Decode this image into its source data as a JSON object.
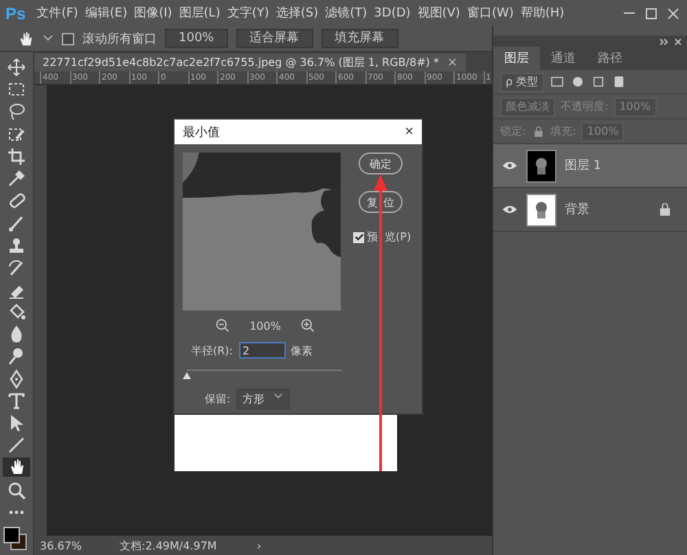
{
  "app": {
    "logo": "Ps"
  },
  "menu": [
    "文件(F)",
    "编辑(E)",
    "图像(I)",
    "图层(L)",
    "文字(Y)",
    "选择(S)",
    "滤镜(T)",
    "3D(D)",
    "视图(V)",
    "窗口(W)",
    "帮助(H)"
  ],
  "options_bar": {
    "scroll_all": {
      "label": "滚动所有窗口",
      "checked": false
    },
    "buttons": [
      "100%",
      "适合屏幕",
      "填充屏幕"
    ]
  },
  "document_tab": {
    "title": "22771cf29d51e4c8b2c7ac2e2f7c6755.jpeg @ 36.7% (图层 1, RGB/8#) *",
    "close": "×"
  },
  "ruler": [
    "400",
    "300",
    "200",
    "100",
    "0",
    "100",
    "200",
    "300",
    "400",
    "500",
    "600",
    "700",
    "800",
    "900",
    "1000",
    "1"
  ],
  "tools": [
    {
      "kind": "move",
      "selected": false
    },
    {
      "kind": "marquee",
      "selected": false
    },
    {
      "kind": "lasso",
      "selected": false
    },
    {
      "kind": "quickselect",
      "selected": false
    },
    {
      "kind": "crop",
      "selected": false
    },
    {
      "kind": "eyedropper",
      "selected": false
    },
    {
      "kind": "healing",
      "selected": false
    },
    {
      "kind": "brush",
      "selected": false
    },
    {
      "kind": "stamp",
      "selected": false
    },
    {
      "kind": "historybrush",
      "selected": false
    },
    {
      "kind": "eraser",
      "selected": false
    },
    {
      "kind": "bucket",
      "selected": false
    },
    {
      "kind": "blur",
      "selected": false
    },
    {
      "kind": "dodge",
      "selected": false
    },
    {
      "kind": "pen",
      "selected": false
    },
    {
      "kind": "type",
      "selected": false
    },
    {
      "kind": "pathselect",
      "selected": false
    },
    {
      "kind": "line",
      "selected": false
    },
    {
      "kind": "hand",
      "selected": true
    },
    {
      "kind": "zoom",
      "selected": false
    },
    {
      "kind": "more",
      "selected": false
    }
  ],
  "dialog": {
    "title": "最小值",
    "close": "×",
    "zoom_level": "100%",
    "radius_label": "半径(R):",
    "radius_value": "2",
    "radius_unit": "像素",
    "slider": {
      "level": 0.0
    },
    "preserve_label": "保留:",
    "preserve_value": "方形",
    "buttons": [
      "确定",
      "复位"
    ],
    "preview": {
      "label": "预览(P)",
      "checked": true
    }
  },
  "layers_panel": {
    "tabs": [
      {
        "label": "图层",
        "selected": true
      },
      {
        "label": "通道",
        "selected": false
      },
      {
        "label": "路径",
        "selected": false
      }
    ],
    "filter": "ρ 类型",
    "blend_mode": "颜色减淡",
    "opacity_label": "不透明度:",
    "opacity": "100%",
    "lock_label": "锁定:",
    "fill_label": "填充:",
    "fill": "100%",
    "layers": [
      {
        "name": "图层 1",
        "visible": true,
        "selected": true,
        "locked": false,
        "kind": "dark"
      },
      {
        "name": "背景",
        "visible": true,
        "selected": false,
        "locked": true,
        "kind": "light"
      }
    ]
  },
  "status_bar": {
    "zoom": "36.67%",
    "doc": "文档:2.49M/4.97M",
    "arrow": "›"
  }
}
